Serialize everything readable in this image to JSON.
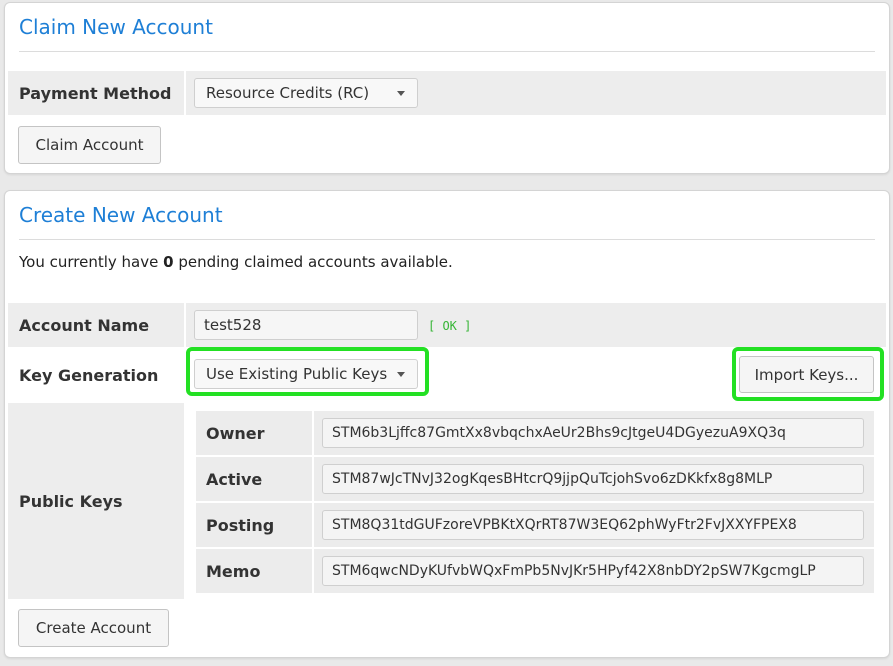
{
  "claim": {
    "title": "Claim New Account",
    "payment_label": "Payment Method",
    "payment_value": "Resource Credits (RC)",
    "claim_button": "Claim Account"
  },
  "create": {
    "title": "Create New Account",
    "info_prefix": "You currently have ",
    "pending_count": "0",
    "info_suffix": " pending claimed accounts available.",
    "account_name_label": "Account Name",
    "account_name_value": "test528",
    "account_status": "[ OK ]",
    "key_gen_label": "Key Generation",
    "key_gen_value": "Use Existing Public Keys",
    "import_button": "Import Keys...",
    "public_keys_label": "Public Keys",
    "keys": [
      {
        "label": "Owner",
        "value": "STM6b3Ljffc87GmtXx8vbqchxAeUr2Bhs9cJtgeU4DGyezuA9XQ3q"
      },
      {
        "label": "Active",
        "value": "STM87wJcTNvJ32ogKqesBHtcrQ9jjpQuTcjohSvo6zDKkfx8g8MLP"
      },
      {
        "label": "Posting",
        "value": "STM8Q31tdGUFzoreVPBKtXQrRT87W3EQ62phWyFtr2FvJXXYFPEX8"
      },
      {
        "label": "Memo",
        "value": "STM6qwcNDyKUfvbWQxFmPb5NvJKr5HPyf42X8nbDY2pSW7KgcmgLP"
      }
    ],
    "create_button": "Create Account"
  },
  "colors": {
    "title_blue": "#1e7fd6",
    "highlight_green": "#23e023",
    "ok_green": "#35b535"
  }
}
